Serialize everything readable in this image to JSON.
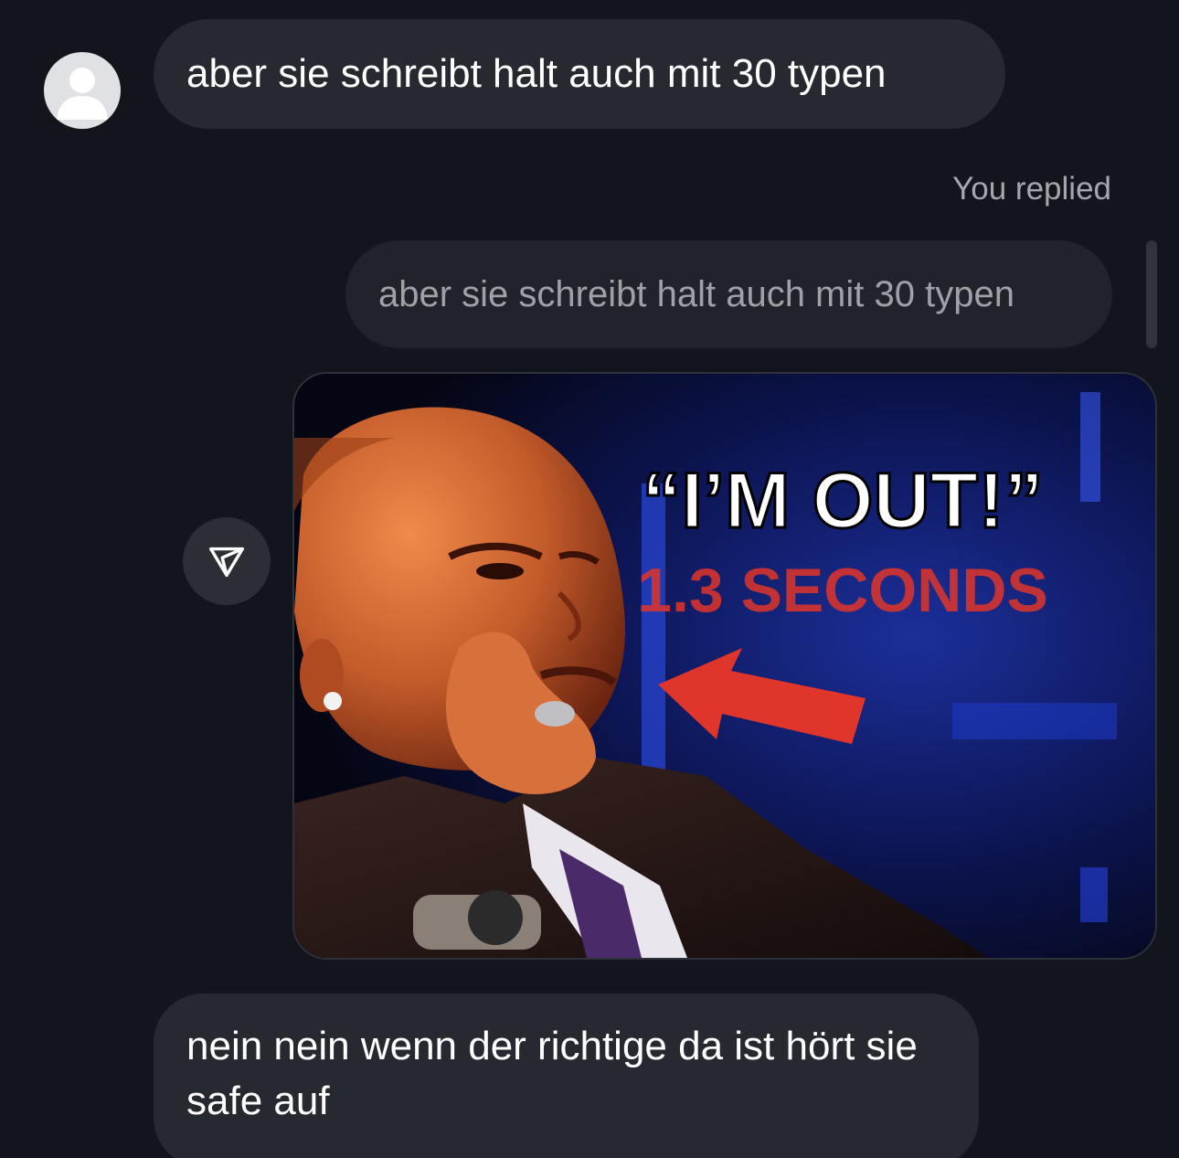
{
  "conversation": {
    "messages": [
      {
        "sender": "contact",
        "text": "aber sie schreibt halt auch mit 30 typen",
        "avatar_icon": "user-silhouette-icon"
      },
      {
        "sender": "me",
        "reply_label": "You replied",
        "quoted_text": "aber sie schreibt halt auch mit 30 typen",
        "media": {
          "type": "image",
          "overlay_title": "“I’M OUT!”",
          "overlay_subtitle": "1.3 SECONDS"
        },
        "share_icon": "send-icon"
      },
      {
        "sender": "contact",
        "text": "nein nein wenn der richtige da ist hört sie safe auf"
      }
    ]
  },
  "colors": {
    "background": "#12151b",
    "bubble": "#262930",
    "quoted_bubble": "#202329",
    "muted_text": "#a4a7ad",
    "overlay_red": "#e0352a"
  }
}
